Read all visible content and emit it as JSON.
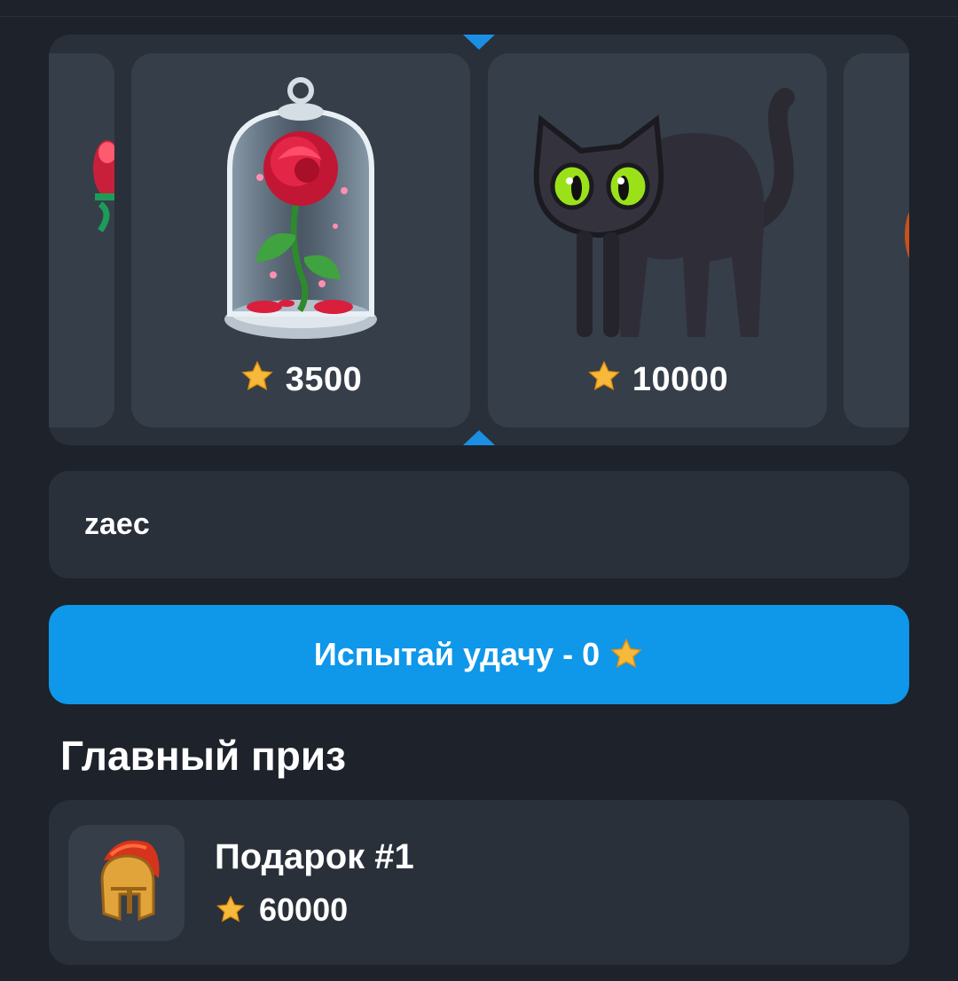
{
  "carousel": {
    "items": [
      {
        "name": "rose-under-glass",
        "price": "3500"
      },
      {
        "name": "black-cat",
        "price": "10000"
      }
    ],
    "pointer_color": "#1a8fe3"
  },
  "name_field": {
    "value": "zaec"
  },
  "spin_button": {
    "label": "Испытай удачу - 0"
  },
  "main_prize": {
    "title": "Главный приз",
    "item": {
      "name": "Подарок #1",
      "price": "60000",
      "icon": "spartan-helmet-icon"
    }
  },
  "colors": {
    "background": "#1e222a",
    "card": "#2a3039",
    "inner_card": "#363e49",
    "accent": "#0f97ea",
    "star": "#f6b93b"
  }
}
